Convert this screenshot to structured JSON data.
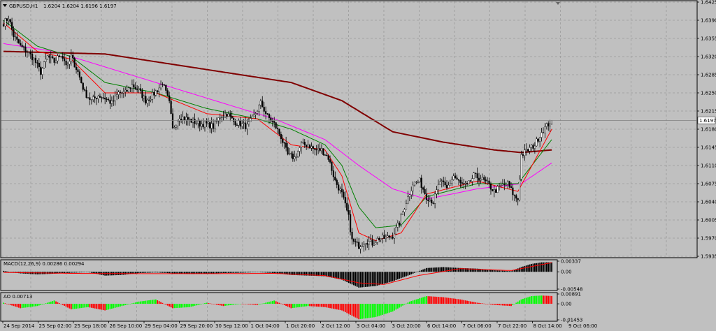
{
  "chart_data": {
    "type": "candlestick",
    "symbol": "GBPUSD,H1",
    "ohlc_readout": "1.6204 1.6204 1.6196 1.6197",
    "current_price": 1.6197,
    "current_price_label": "1.6197",
    "price_axis": {
      "ylim": [
        1.5935,
        1.6425
      ],
      "ticks": [
        "1.6425",
        "1.6390",
        "1.6355",
        "1.6320",
        "1.6285",
        "1.6250",
        "1.6215",
        "1.6180",
        "1.6145",
        "1.6110",
        "1.6075",
        "1.6040",
        "1.6005",
        "1.5970",
        "1.5935"
      ]
    },
    "time_axis": {
      "labels": [
        "24 Sep 2014",
        "25 Sep 02:00",
        "25 Sep 18:00",
        "26 Sep 10:00",
        "29 Sep 04:00",
        "29 Sep 20:00",
        "30 Sep 12:00",
        "1 Oct 04:00",
        "1 Oct 20:00",
        "2 Oct 12:00",
        "3 Oct 04:00",
        "3 Oct 20:00",
        "6 Oct 14:00",
        "7 Oct 06:00",
        "7 Oct 22:00",
        "8 Oct 14:00",
        "9 Oct 06:00"
      ]
    },
    "price_path_keypoints": [
      [
        0,
        1.6385
      ],
      [
        3,
        1.6395
      ],
      [
        6,
        1.636
      ],
      [
        10,
        1.634
      ],
      [
        14,
        1.633
      ],
      [
        18,
        1.6315
      ],
      [
        22,
        1.629
      ],
      [
        26,
        1.632
      ],
      [
        30,
        1.631
      ],
      [
        34,
        1.6325
      ],
      [
        38,
        1.63
      ],
      [
        40,
        1.632
      ],
      [
        44,
        1.629
      ],
      [
        48,
        1.625
      ],
      [
        52,
        1.6235
      ],
      [
        56,
        1.6245
      ],
      [
        60,
        1.624
      ],
      [
        64,
        1.623
      ],
      [
        68,
        1.625
      ],
      [
        72,
        1.625
      ],
      [
        76,
        1.6265
      ],
      [
        80,
        1.6255
      ],
      [
        84,
        1.6235
      ],
      [
        88,
        1.6245
      ],
      [
        92,
        1.626
      ],
      [
        94,
        1.627
      ],
      [
        98,
        1.623
      ],
      [
        100,
        1.618
      ],
      [
        104,
        1.6205
      ],
      [
        108,
        1.62
      ],
      [
        112,
        1.6195
      ],
      [
        116,
        1.619
      ],
      [
        120,
        1.619
      ],
      [
        124,
        1.6185
      ],
      [
        128,
        1.6205
      ],
      [
        132,
        1.621
      ],
      [
        136,
        1.6195
      ],
      [
        140,
        1.619
      ],
      [
        144,
        1.6185
      ],
      [
        148,
        1.6205
      ],
      [
        152,
        1.623
      ],
      [
        156,
        1.6205
      ],
      [
        160,
        1.619
      ],
      [
        164,
        1.6165
      ],
      [
        168,
        1.613
      ],
      [
        172,
        1.6125
      ],
      [
        176,
        1.615
      ],
      [
        180,
        1.615
      ],
      [
        184,
        1.614
      ],
      [
        188,
        1.614
      ],
      [
        192,
        1.6125
      ],
      [
        196,
        1.608
      ],
      [
        200,
        1.6055
      ],
      [
        204,
        1.601
      ],
      [
        206,
        1.5965
      ],
      [
        210,
        1.5955
      ],
      [
        214,
        1.5965
      ],
      [
        218,
        1.596
      ],
      [
        222,
        1.597
      ],
      [
        226,
        1.597
      ],
      [
        230,
        1.5975
      ],
      [
        234,
        1.6
      ],
      [
        238,
        1.604
      ],
      [
        242,
        1.6075
      ],
      [
        246,
        1.608
      ],
      [
        250,
        1.605
      ],
      [
        254,
        1.604
      ],
      [
        258,
        1.608
      ],
      [
        262,
        1.6065
      ],
      [
        266,
        1.609
      ],
      [
        270,
        1.6075
      ],
      [
        274,
        1.607
      ],
      [
        278,
        1.609
      ],
      [
        282,
        1.6085
      ],
      [
        286,
        1.6075
      ],
      [
        290,
        1.606
      ],
      [
        294,
        1.607
      ],
      [
        298,
        1.6075
      ],
      [
        302,
        1.605
      ],
      [
        304,
        1.6045
      ],
      [
        306,
        1.613
      ],
      [
        310,
        1.614
      ],
      [
        314,
        1.615
      ],
      [
        318,
        1.6175
      ],
      [
        322,
        1.619
      ],
      [
        324,
        1.6197
      ]
    ],
    "moving_averages": [
      {
        "color": "#800000",
        "keypoints": [
          [
            0,
            1.633
          ],
          [
            60,
            1.6325
          ],
          [
            100,
            1.6305
          ],
          [
            140,
            1.6285
          ],
          [
            170,
            1.627
          ],
          [
            200,
            1.6235
          ],
          [
            230,
            1.6175
          ],
          [
            260,
            1.6155
          ],
          [
            290,
            1.614
          ],
          [
            306,
            1.6135
          ],
          [
            324,
            1.614
          ]
        ]
      },
      {
        "color": "#ff00ff",
        "keypoints": [
          [
            0,
            1.6345
          ],
          [
            30,
            1.633
          ],
          [
            60,
            1.63
          ],
          [
            90,
            1.627
          ],
          [
            120,
            1.624
          ],
          [
            160,
            1.62
          ],
          [
            190,
            1.616
          ],
          [
            210,
            1.611
          ],
          [
            230,
            1.6065
          ],
          [
            250,
            1.6045
          ],
          [
            280,
            1.6065
          ],
          [
            306,
            1.6075
          ],
          [
            324,
            1.6115
          ]
        ]
      },
      {
        "color": "#008000",
        "keypoints": [
          [
            0,
            1.639
          ],
          [
            20,
            1.634
          ],
          [
            40,
            1.632
          ],
          [
            60,
            1.627
          ],
          [
            90,
            1.625
          ],
          [
            120,
            1.622
          ],
          [
            150,
            1.62
          ],
          [
            170,
            1.618
          ],
          [
            190,
            1.615
          ],
          [
            200,
            1.611
          ],
          [
            210,
            1.603
          ],
          [
            220,
            1.599
          ],
          [
            235,
            1.5995
          ],
          [
            250,
            1.605
          ],
          [
            280,
            1.6075
          ],
          [
            304,
            1.6075
          ],
          [
            324,
            1.616
          ]
        ]
      },
      {
        "color": "#ff0000",
        "keypoints": [
          [
            0,
            1.6385
          ],
          [
            20,
            1.633
          ],
          [
            40,
            1.6315
          ],
          [
            60,
            1.625
          ],
          [
            90,
            1.625
          ],
          [
            120,
            1.621
          ],
          [
            150,
            1.62
          ],
          [
            170,
            1.615
          ],
          [
            190,
            1.614
          ],
          [
            200,
            1.609
          ],
          [
            210,
            1.598
          ],
          [
            220,
            1.5965
          ],
          [
            235,
            1.598
          ],
          [
            250,
            1.6055
          ],
          [
            280,
            1.608
          ],
          [
            304,
            1.606
          ],
          [
            324,
            1.618
          ]
        ]
      }
    ],
    "macd": {
      "label": "MACD(12,26,9) 0.00286 0.00294",
      "ticks": [
        "0.00337",
        "0.00",
        "-0.00548"
      ],
      "ylim": [
        -0.00548,
        0.00337
      ],
      "histogram_keypoints": [
        [
          0,
          0.0003
        ],
        [
          10,
          -0.0005
        ],
        [
          20,
          -0.0008
        ],
        [
          30,
          -0.0006
        ],
        [
          40,
          -0.0003
        ],
        [
          50,
          -0.0001
        ],
        [
          60,
          -0.0012
        ],
        [
          70,
          -0.001
        ],
        [
          80,
          -0.0004
        ],
        [
          90,
          -0.0002
        ],
        [
          100,
          -0.0005
        ],
        [
          110,
          -0.0007
        ],
        [
          120,
          -0.0006
        ],
        [
          130,
          -0.0004
        ],
        [
          140,
          -0.0003
        ],
        [
          150,
          -0.0001
        ],
        [
          160,
          -0.0004
        ],
        [
          170,
          -0.001
        ],
        [
          180,
          -0.0012
        ],
        [
          190,
          -0.0014
        ],
        [
          200,
          -0.0025
        ],
        [
          210,
          -0.005
        ],
        [
          220,
          -0.0045
        ],
        [
          230,
          -0.003
        ],
        [
          240,
          -0.001
        ],
        [
          250,
          0.0012
        ],
        [
          260,
          0.0015
        ],
        [
          270,
          0.0012
        ],
        [
          280,
          0.001
        ],
        [
          290,
          0.0005
        ],
        [
          300,
          0.0002
        ],
        [
          306,
          0.0015
        ],
        [
          312,
          0.0025
        ],
        [
          318,
          0.003
        ],
        [
          324,
          0.003
        ]
      ],
      "signal_keypoints": [
        [
          0,
          -0.0002
        ],
        [
          40,
          -0.0005
        ],
        [
          80,
          -0.0006
        ],
        [
          120,
          -0.0006
        ],
        [
          160,
          -0.0005
        ],
        [
          190,
          -0.0012
        ],
        [
          210,
          -0.0035
        ],
        [
          225,
          -0.004
        ],
        [
          245,
          -0.0012
        ],
        [
          270,
          0.001
        ],
        [
          300,
          0.0004
        ],
        [
          324,
          0.0029
        ]
      ]
    },
    "ao": {
      "label": "AO 0.00713",
      "ticks": [
        "0.00891",
        "0.00",
        "-0.01453"
      ],
      "ylim": [
        -0.01453,
        0.00891
      ],
      "keypoints": [
        [
          0,
          0.001
        ],
        [
          10,
          -0.004
        ],
        [
          20,
          -0.002
        ],
        [
          30,
          0.003
        ],
        [
          40,
          -0.005
        ],
        [
          50,
          -0.003
        ],
        [
          60,
          -0.006
        ],
        [
          70,
          -0.002
        ],
        [
          80,
          0.002
        ],
        [
          90,
          0.004
        ],
        [
          100,
          -0.004
        ],
        [
          110,
          -0.003
        ],
        [
          120,
          0.001
        ],
        [
          130,
          -0.002
        ],
        [
          140,
          0.0
        ],
        [
          150,
          -0.001
        ],
        [
          160,
          0.003
        ],
        [
          170,
          -0.004
        ],
        [
          180,
          -0.002
        ],
        [
          190,
          -0.003
        ],
        [
          200,
          -0.006
        ],
        [
          210,
          -0.014
        ],
        [
          220,
          -0.012
        ],
        [
          230,
          -0.007
        ],
        [
          240,
          0.002
        ],
        [
          250,
          0.007
        ],
        [
          260,
          0.006
        ],
        [
          270,
          0.004
        ],
        [
          280,
          0.001
        ],
        [
          290,
          -0.001
        ],
        [
          300,
          -0.002
        ],
        [
          306,
          0.004
        ],
        [
          312,
          0.007
        ],
        [
          318,
          0.0075
        ],
        [
          324,
          0.0071
        ]
      ]
    },
    "colors": {
      "background": "#c0c0c0",
      "grid": "#9a9a9a",
      "candle": "#000000",
      "bull_fill": "#ffffff",
      "current_line": "#808080",
      "macd_hist": "#000000",
      "macd_signal": "#ff0000",
      "ao_up": "#00ff00",
      "ao_down": "#ff0000"
    },
    "grid": true
  }
}
